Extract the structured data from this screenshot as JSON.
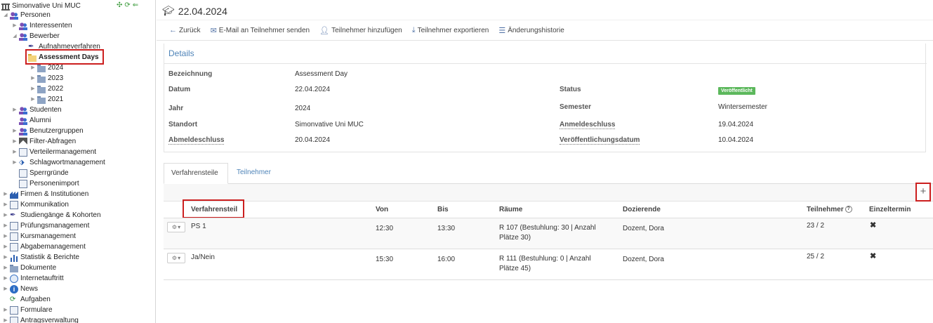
{
  "sidebar": {
    "root": "Simonvative Uni MUC",
    "items": [
      {
        "label": "Personen",
        "level": 1,
        "icon": "people-icon"
      },
      {
        "label": "Interessenten",
        "level": 2,
        "icon": "people-icon"
      },
      {
        "label": "Bewerber",
        "level": 2,
        "icon": "people-icon"
      },
      {
        "label": "Aufnahmeverfahren",
        "level": 3,
        "icon": "feather-icon"
      },
      {
        "label": "Assessment Days",
        "level": 3,
        "icon": "folder-open-icon"
      },
      {
        "label": "2024",
        "level": 4,
        "icon": "folder-icon"
      },
      {
        "label": "2023",
        "level": 4,
        "icon": "folder-icon"
      },
      {
        "label": "2022",
        "level": 4,
        "icon": "folder-icon"
      },
      {
        "label": "2021",
        "level": 4,
        "icon": "folder-icon"
      },
      {
        "label": "Studenten",
        "level": 2,
        "icon": "people-icon"
      },
      {
        "label": "Alumni",
        "level": 2,
        "icon": "people-icon"
      },
      {
        "label": "Benutzergruppen",
        "level": 2,
        "icon": "people-icon"
      },
      {
        "label": "Filter-Abfragen",
        "level": 2,
        "icon": "filter-icon"
      },
      {
        "label": "Verteilermanagement",
        "level": 2,
        "icon": "list-icon"
      },
      {
        "label": "Schlagwortmanagement",
        "level": 2,
        "icon": "tag-icon"
      },
      {
        "label": "Sperrgründe",
        "level": 2,
        "icon": "block-icon"
      },
      {
        "label": "Personenimport",
        "level": 2,
        "icon": "import-icon"
      },
      {
        "label": "Firmen & Institutionen",
        "level": 1,
        "icon": "factory-icon"
      },
      {
        "label": "Kommunikation",
        "level": 1,
        "icon": "mail-icon"
      },
      {
        "label": "Studiengänge & Kohorten",
        "level": 1,
        "icon": "feather-icon"
      },
      {
        "label": "Prüfungsmanagement",
        "level": 1,
        "icon": "checklist-icon"
      },
      {
        "label": "Kursmanagement",
        "level": 1,
        "icon": "book-icon"
      },
      {
        "label": "Abgabemanagement",
        "level": 1,
        "icon": "inbox-icon"
      },
      {
        "label": "Statistik & Berichte",
        "level": 1,
        "icon": "chart-icon"
      },
      {
        "label": "Dokumente",
        "level": 1,
        "icon": "folder-icon"
      },
      {
        "label": "Internetauftritt",
        "level": 1,
        "icon": "globe-icon"
      },
      {
        "label": "News",
        "level": 1,
        "icon": "info-icon"
      },
      {
        "label": "Aufgaben",
        "level": 1,
        "icon": "check-icon"
      },
      {
        "label": "Formulare",
        "level": 1,
        "icon": "form-icon"
      },
      {
        "label": "Antragsverwaltung",
        "level": 1,
        "icon": "form-icon"
      }
    ]
  },
  "header": {
    "title": "22.04.2024",
    "icon": "graduation-cap-icon"
  },
  "toolbar": {
    "back": "Zurück",
    "email": "E-Mail an Teilnehmer senden",
    "add": "Teilnehmer hinzufügen",
    "export": "Teilnehmer exportieren",
    "history": "Änderungshistorie"
  },
  "details": {
    "title": "Details",
    "bezeichnung_label": "Bezeichnung",
    "bezeichnung_value": "Assessment Day",
    "datum_label": "Datum",
    "datum_value": "22.04.2024",
    "status_label": "Status",
    "status_value": "Veröffentlicht",
    "jahr_label": "Jahr",
    "jahr_value": "2024",
    "semester_label": "Semester",
    "semester_value": "Wintersemester",
    "standort_label": "Standort",
    "standort_value": "Simonvative Uni MUC",
    "anmeldeschluss_label": "Anmeldeschluss",
    "anmeldeschluss_value": "19.04.2024",
    "abmeldeschluss_label": "Abmeldeschluss",
    "abmeldeschluss_value": "20.04.2024",
    "veroeffentlichung_label": "Veröffentlichungsdatum",
    "veroeffentlichung_value": "10.04.2024",
    "status_color": "#5cb85c"
  },
  "tabs": {
    "active": "Verfahrensteile",
    "inactive": "Teilnehmer"
  },
  "table": {
    "headers": {
      "verfahrensteil": "Verfahrensteil",
      "von": "Von",
      "bis": "Bis",
      "raeume": "Räume",
      "dozierende": "Dozierende",
      "teilnehmer": "Teilnehmer",
      "einzeltermin": "Einzeltermin"
    },
    "rows": [
      {
        "verfahrensteil": "PS 1",
        "von": "12:30",
        "bis": "13:30",
        "raeume": "R 107 (Bestuhlung: 30 | Anzahl Plätze 30)",
        "dozierende": "Dozent, Dora",
        "teilnehmer": "23 / 2",
        "einzeltermin": "✖"
      },
      {
        "verfahrensteil": "Ja/Nein",
        "von": "15:30",
        "bis": "16:00",
        "raeume": "R 111 (Bestuhlung: 0 | Anzahl Plätze 45)",
        "dozierende": "Dozent, Dora",
        "teilnehmer": "25 / 2",
        "einzeltermin": "✖"
      }
    ],
    "add_button": "+"
  },
  "colors": {
    "accent": "#4f84b8",
    "highlight": "#cc1f1f"
  }
}
